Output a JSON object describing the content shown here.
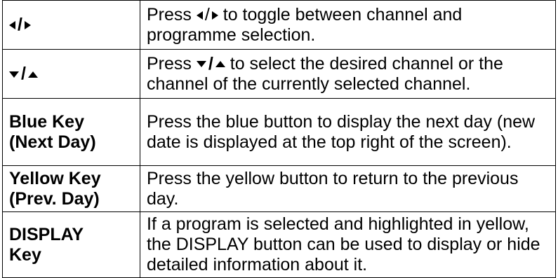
{
  "rows": [
    {
      "key_label": "",
      "key_icons": [
        "left-triangle",
        "right-triangle"
      ],
      "separator": "/",
      "desc_prefix": "Press",
      "desc_icons": [
        "left-triangle",
        "right-triangle"
      ],
      "desc_rest": "to toggle between channel and programme selection."
    },
    {
      "key_label": "",
      "key_icons": [
        "down-triangle",
        "up-triangle"
      ],
      "separator": "/",
      "desc_prefix": "Press",
      "desc_icons": [
        "down-triangle",
        "up-triangle"
      ],
      "desc_rest": "to select the desired channel or the channel of the currently selected channel."
    },
    {
      "key_label_line1": "Blue Key",
      "key_label_line2": "(Next Day)",
      "desc": "Press the blue button to display the next day (new date is displayed at the top right of the screen)."
    },
    {
      "key_label_line1": "Yellow Key",
      "key_label_line2": "(Prev. Day)",
      "desc": "Press the yellow button to return to the previous day."
    },
    {
      "key_label_line1": "DISPLAY",
      "key_label_line2": "Key",
      "desc": "If a program is selected and highlighted in yellow, the DISPLAY button can be used to display or hide detailed information about it."
    }
  ]
}
